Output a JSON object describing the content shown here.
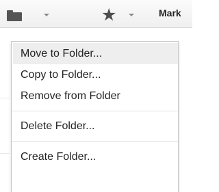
{
  "toolbar": {
    "folder_button": {
      "icon": "folder-icon",
      "caret_icon": "chevron-down-icon"
    },
    "star_button": {
      "icon": "star-icon",
      "glyph": "★",
      "caret_icon": "chevron-down-icon"
    },
    "mark_label": "Mark"
  },
  "folder_menu": {
    "items": [
      {
        "label": "Move to Folder...",
        "highlighted": true
      },
      {
        "label": "Copy to Folder..."
      },
      {
        "label": "Remove from Folder"
      },
      {
        "label": "Delete Folder..."
      },
      {
        "label": "Create Folder..."
      }
    ],
    "highlight_color": "#eeeeee"
  }
}
